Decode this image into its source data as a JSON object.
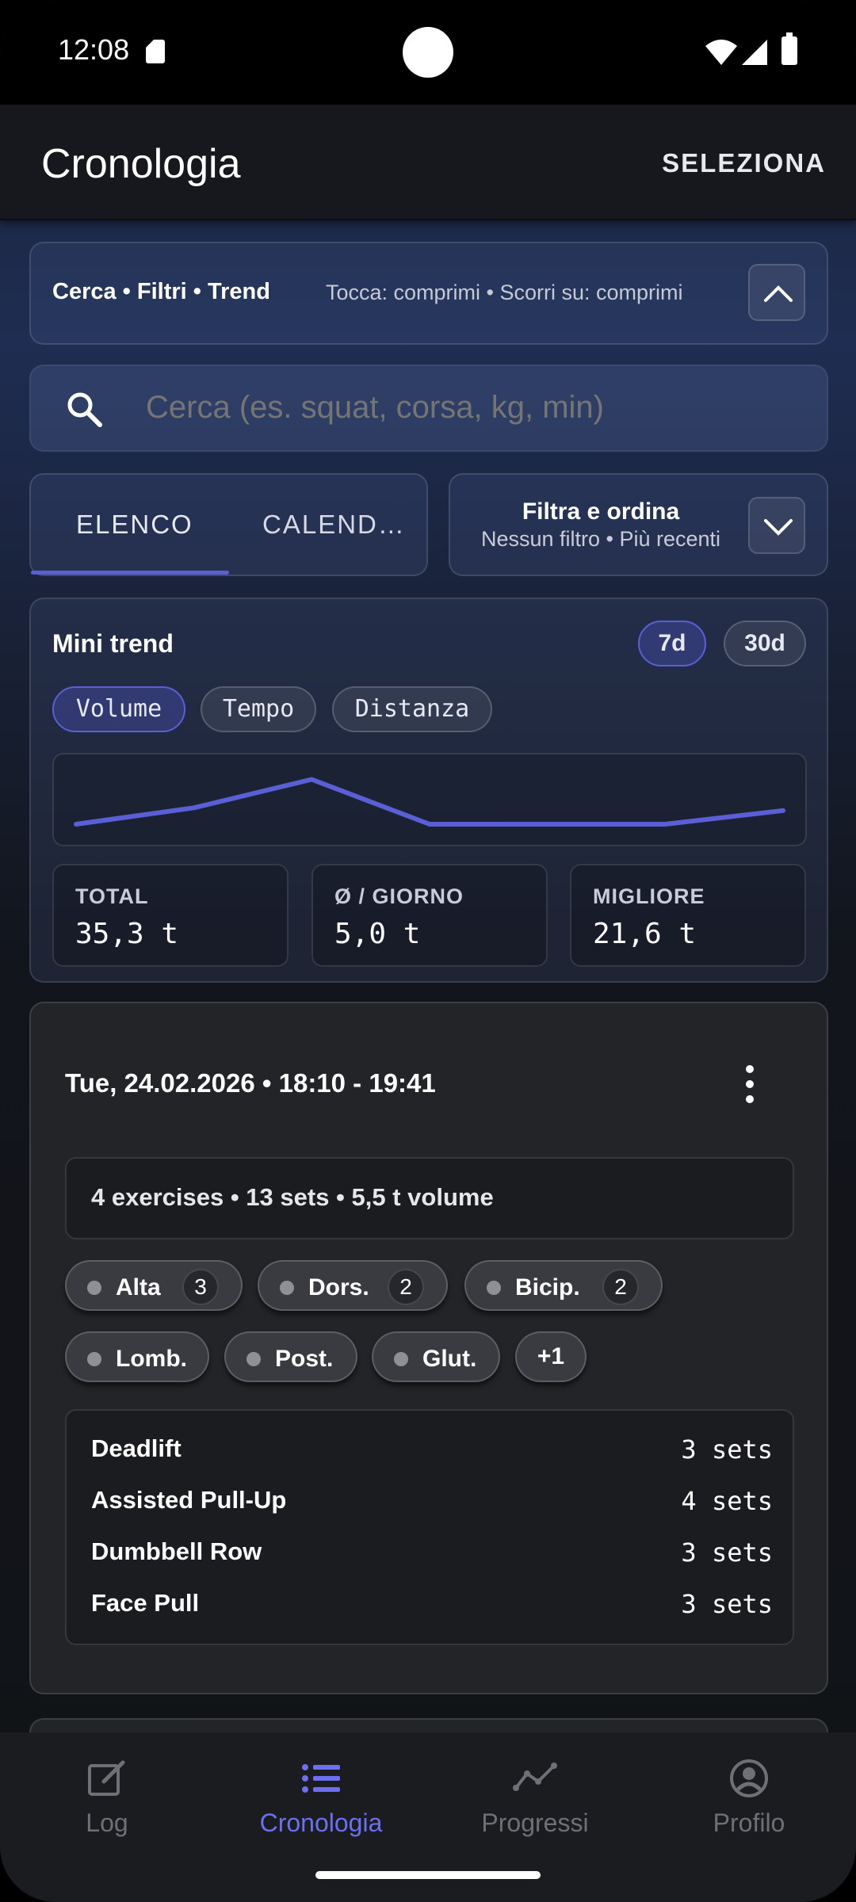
{
  "status": {
    "time": "12:08"
  },
  "appbar": {
    "title": "Cronologia",
    "action": "SELEZIONA"
  },
  "search_header": {
    "title": "Cerca • Filtri • Trend",
    "hint": "Tocca: comprimi • Scorri su: comprimi"
  },
  "search": {
    "placeholder": "Cerca (es. squat, corsa, kg, min)"
  },
  "tabs": [
    {
      "label": "ELENCO",
      "selected": true
    },
    {
      "label": "CALEND…",
      "selected": false
    }
  ],
  "filter": {
    "title": "Filtra e ordina",
    "subtitle": "Nessun filtro • Più recenti"
  },
  "trend": {
    "title": "Mini trend",
    "ranges": [
      {
        "label": "7d",
        "selected": true
      },
      {
        "label": "30d",
        "selected": false
      }
    ],
    "metrics": [
      {
        "label": "Volume",
        "selected": true
      },
      {
        "label": "Tempo",
        "selected": false
      },
      {
        "label": "Distanza",
        "selected": false
      }
    ],
    "stats": [
      {
        "label": "TOTAL",
        "value": "35,3 t"
      },
      {
        "label": "Ø / GIORNO",
        "value": "5,0 t"
      },
      {
        "label": "MIGLIORE",
        "value": "21,6 t"
      }
    ],
    "accent": "#5b5fd6"
  },
  "chart_data": {
    "type": "line",
    "x": [
      1,
      2,
      3,
      4,
      5,
      6,
      7
    ],
    "values": [
      0,
      3.0,
      8.2,
      0,
      0,
      0,
      2.5
    ],
    "title": "",
    "xlabel": "",
    "ylabel": "",
    "ylim": [
      0,
      9
    ]
  },
  "session": {
    "date": "Tue, 24.02.2026 • 18:10 - 19:41",
    "summary": "4 exercises • 13 sets • 5,5 t volume",
    "chips": [
      {
        "label": "Alta",
        "count": "3"
      },
      {
        "label": "Dors.",
        "count": "2"
      },
      {
        "label": "Bicip.",
        "count": "2"
      },
      {
        "label": "Lomb.",
        "count": ""
      },
      {
        "label": "Post.",
        "count": ""
      },
      {
        "label": "Glut.",
        "count": ""
      }
    ],
    "more": "+1",
    "exercises": [
      {
        "name": "Deadlift",
        "sets": "3 sets"
      },
      {
        "name": "Assisted Pull-Up",
        "sets": "4 sets"
      },
      {
        "name": "Dumbbell Row",
        "sets": "3 sets"
      },
      {
        "name": "Face Pull",
        "sets": "3 sets"
      }
    ]
  },
  "nav": [
    {
      "label": "Log",
      "icon": "edit-icon"
    },
    {
      "label": "Cronologia",
      "icon": "list-icon",
      "active": true
    },
    {
      "label": "Progressi",
      "icon": "trend-icon"
    },
    {
      "label": "Profilo",
      "icon": "profile-icon"
    }
  ]
}
